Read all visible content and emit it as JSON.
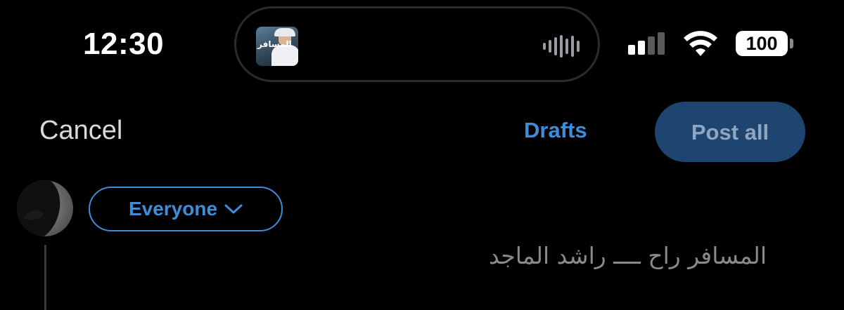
{
  "status_bar": {
    "time": "12:30",
    "battery_percent": "100",
    "signal_bars_active": 2,
    "signal_bars_total": 4
  },
  "now_playing": {
    "album_art_icon": "album-art",
    "album_text": "المسافر",
    "waveform_icon": "audio-waveform-icon"
  },
  "compose": {
    "cancel_label": "Cancel",
    "drafts_label": "Drafts",
    "post_all_label": "Post all",
    "audience_label": "Everyone",
    "text": "المسافر راح ــــ راشد الماجد"
  },
  "colors": {
    "accent": "#3f8dd9",
    "post_button_bg": "#1e4470",
    "post_button_text": "#8ea6bf",
    "background": "#000000"
  }
}
